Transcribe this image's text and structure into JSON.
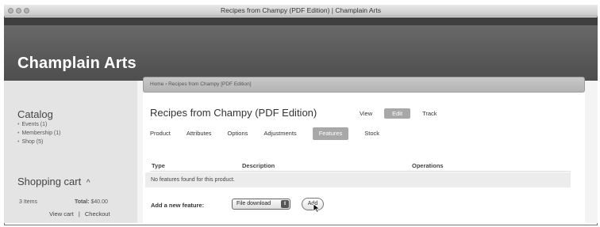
{
  "window": {
    "title": "Recipes from Champy (PDF Edition) | Champlain Arts"
  },
  "site": {
    "name": "Champlain Arts"
  },
  "breadcrumb": "Home › Recipes from Champy [PDF Edition]",
  "sidebar": {
    "catalog": {
      "title": "Catalog",
      "items": [
        "Events (1)",
        "Membership (1)",
        "Shop (5)"
      ]
    },
    "cart": {
      "title": "Shopping cart",
      "toggle_icon": "caret-up",
      "items_count": "3 Items",
      "total_label": "Total:",
      "total_value": "$40.00",
      "view_cart": "View cart",
      "separator": "|",
      "checkout": "Checkout"
    }
  },
  "node": {
    "title": "Recipes from Champy (PDF Edition)",
    "primary_tabs": [
      "View",
      "Edit",
      "Track"
    ],
    "primary_active": "Edit",
    "secondary_tabs": [
      "Product",
      "Attributes",
      "Options",
      "Adjustments",
      "Features",
      "Stock"
    ],
    "secondary_active": "Features"
  },
  "features_table": {
    "columns": [
      "Type",
      "Description",
      "Operations"
    ],
    "empty_message": "No features found for this product."
  },
  "add_feature": {
    "label": "Add a new feature:",
    "selected_option": "File download",
    "button": "Add"
  },
  "colors": {
    "header": "#5a5a5a",
    "active_tab": "#a8a8a8",
    "sidebar": "#e4e4e4"
  }
}
